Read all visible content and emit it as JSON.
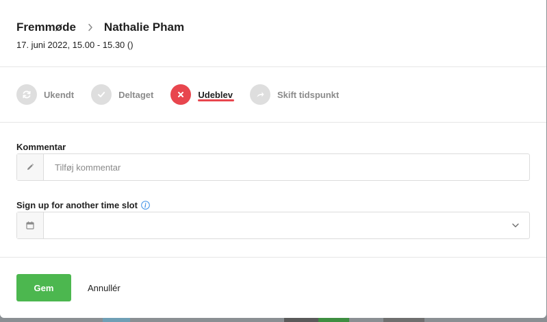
{
  "breadcrumb": {
    "parent": "Fremmøde",
    "current": "Nathalie Pham"
  },
  "subtitle": "17. juni 2022, 15.00 - 15.30 ()",
  "statuses": [
    {
      "label": "Ukendt",
      "icon": "refresh-icon",
      "active": false
    },
    {
      "label": "Deltaget",
      "icon": "check-icon",
      "active": false
    },
    {
      "label": "Udeblev",
      "icon": "close-icon",
      "active": true
    },
    {
      "label": "Skift tidspunkt",
      "icon": "share-arrow-icon",
      "active": false
    }
  ],
  "comment": {
    "label": "Kommentar",
    "placeholder": "Tilføj kommentar",
    "value": ""
  },
  "signup": {
    "label": "Sign up for another time slot",
    "selected": ""
  },
  "actions": {
    "save": "Gem",
    "cancel": "Annullér"
  },
  "colors": {
    "accent_red": "#e8464e",
    "primary_green": "#4cb74f",
    "inactive_gray": "#dedede"
  }
}
